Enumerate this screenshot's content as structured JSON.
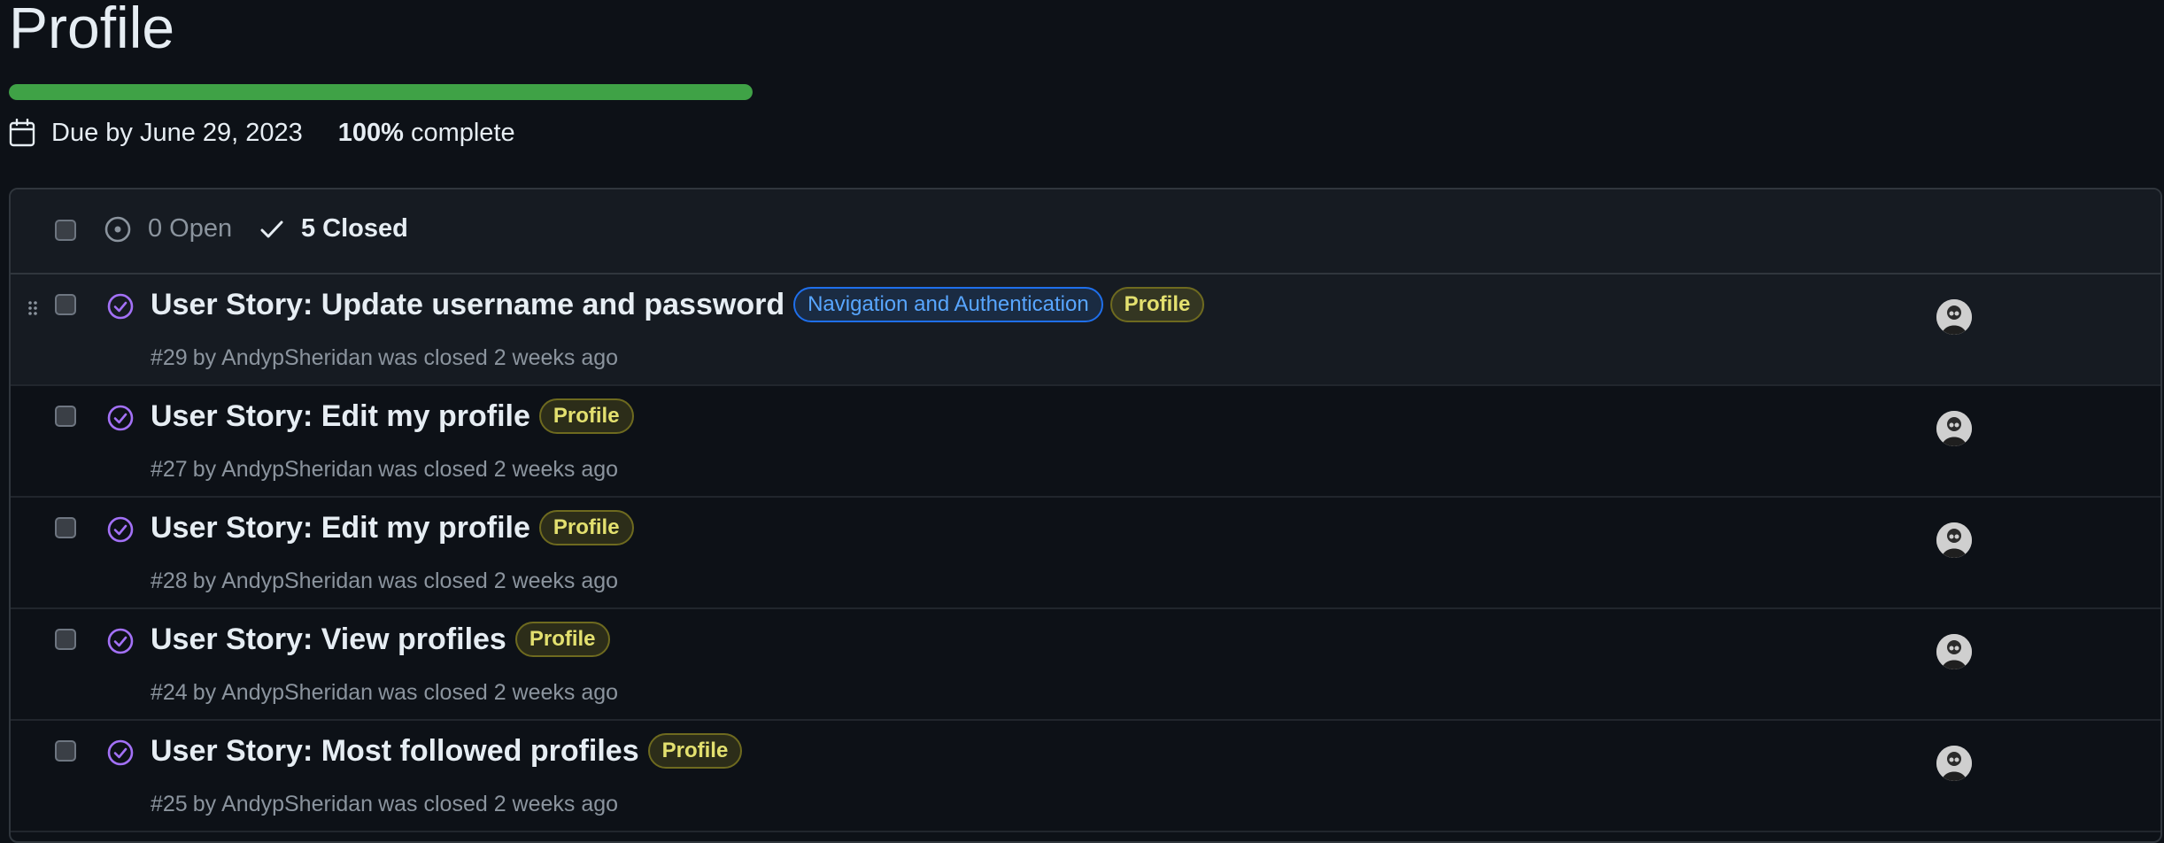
{
  "milestone": {
    "title": "Profile",
    "progress_fraction": 1.0,
    "due_text": "Due by June 29, 2023",
    "percent": "100%",
    "percent_suffix": "complete"
  },
  "header": {
    "open_label": "0 Open",
    "closed_label": "5 Closed"
  },
  "colors": {
    "progress": "#3fa246",
    "closed_icon": "#a371f7"
  },
  "issues": [
    {
      "title": "User Story: Update username and password",
      "labels": [
        "Navigation and Authentication",
        "Profile"
      ],
      "number": "#29",
      "by": "by",
      "author": "AndypSheridan",
      "status": "was closed 2 weeks ago"
    },
    {
      "title": "User Story: Edit my profile",
      "labels": [
        "Profile"
      ],
      "number": "#27",
      "by": "by",
      "author": "AndypSheridan",
      "status": "was closed 2 weeks ago"
    },
    {
      "title": "User Story: Edit my profile",
      "labels": [
        "Profile"
      ],
      "number": "#28",
      "by": "by",
      "author": "AndypSheridan",
      "status": "was closed 2 weeks ago"
    },
    {
      "title": "User Story: View profiles",
      "labels": [
        "Profile"
      ],
      "number": "#24",
      "by": "by",
      "author": "AndypSheridan",
      "status": "was closed 2 weeks ago"
    },
    {
      "title": "User Story: Most followed profiles",
      "labels": [
        "Profile"
      ],
      "number": "#25",
      "by": "by",
      "author": "AndypSheridan",
      "status": "was closed 2 weeks ago"
    }
  ]
}
